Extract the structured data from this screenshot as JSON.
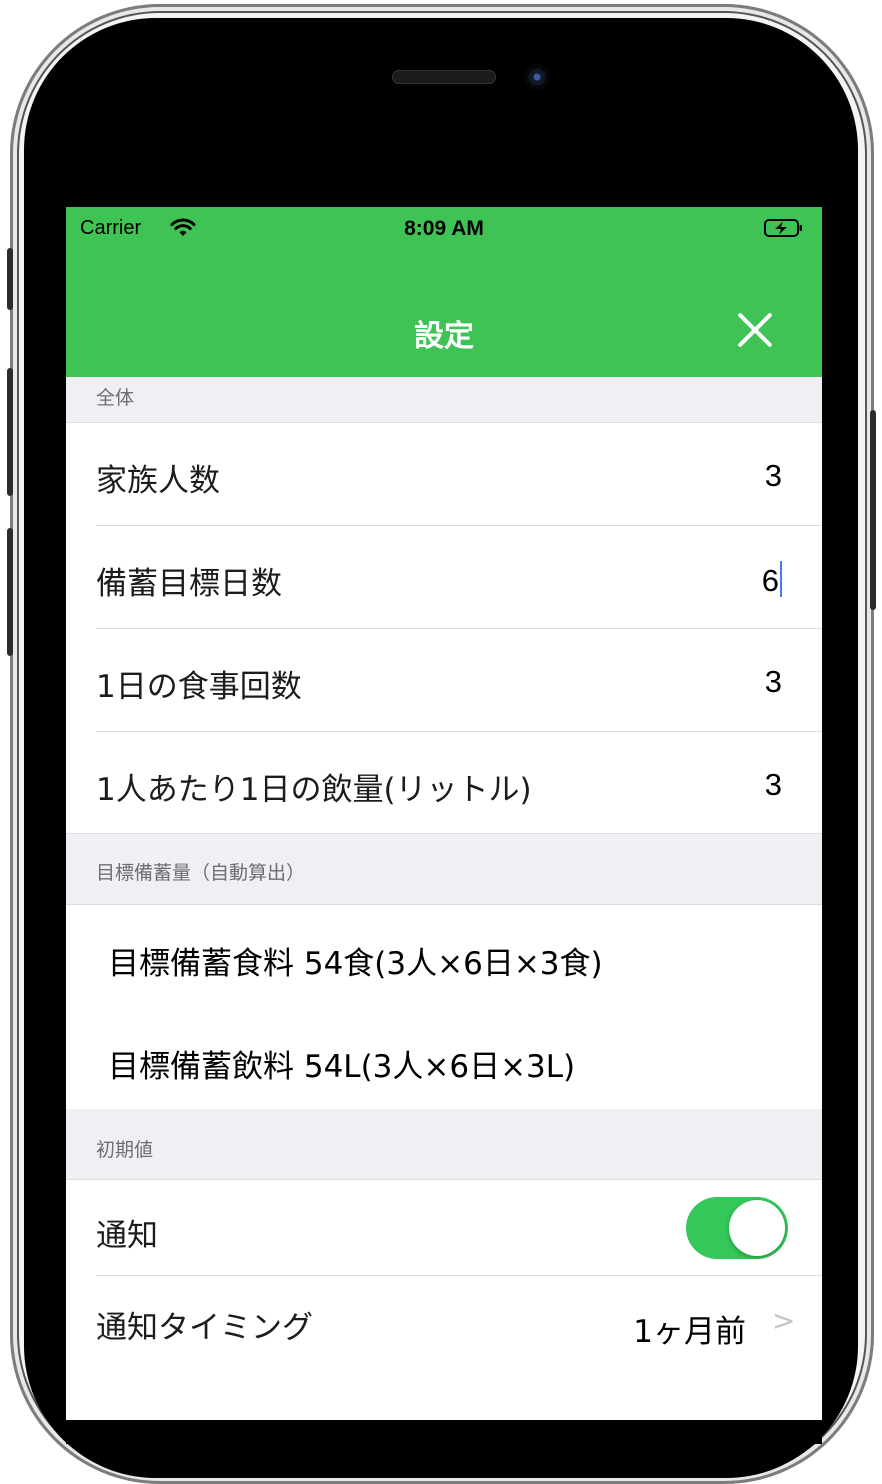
{
  "status_bar": {
    "carrier": "Carrier",
    "time": "8:09 AM"
  },
  "nav": {
    "title": "設定",
    "close_icon": "close-icon"
  },
  "sections": {
    "general": {
      "header": "全体",
      "rows": [
        {
          "label": "家族人数",
          "value": "3"
        },
        {
          "label": "備蓄目標日数",
          "value": "6"
        },
        {
          "label": "1日の食事回数",
          "value": "3"
        },
        {
          "label": "1人あたり1日の飲量(リットル)",
          "value": "3"
        }
      ]
    },
    "target": {
      "header": "目標備蓄量（自動算出）",
      "rows": [
        {
          "text": "目標備蓄食料 54食(3人×6日×3食)"
        },
        {
          "text": "目標備蓄飲料 54L(3人×6日×3L)"
        }
      ]
    },
    "defaults": {
      "header": "初期値",
      "notification_label": "通知",
      "notification_on": true,
      "timing_label": "通知タイミング",
      "timing_value": "1ヶ月前"
    }
  },
  "colors": {
    "nav_green": "#3ec354",
    "toggle_green": "#34c759",
    "background": "#efeff4"
  }
}
